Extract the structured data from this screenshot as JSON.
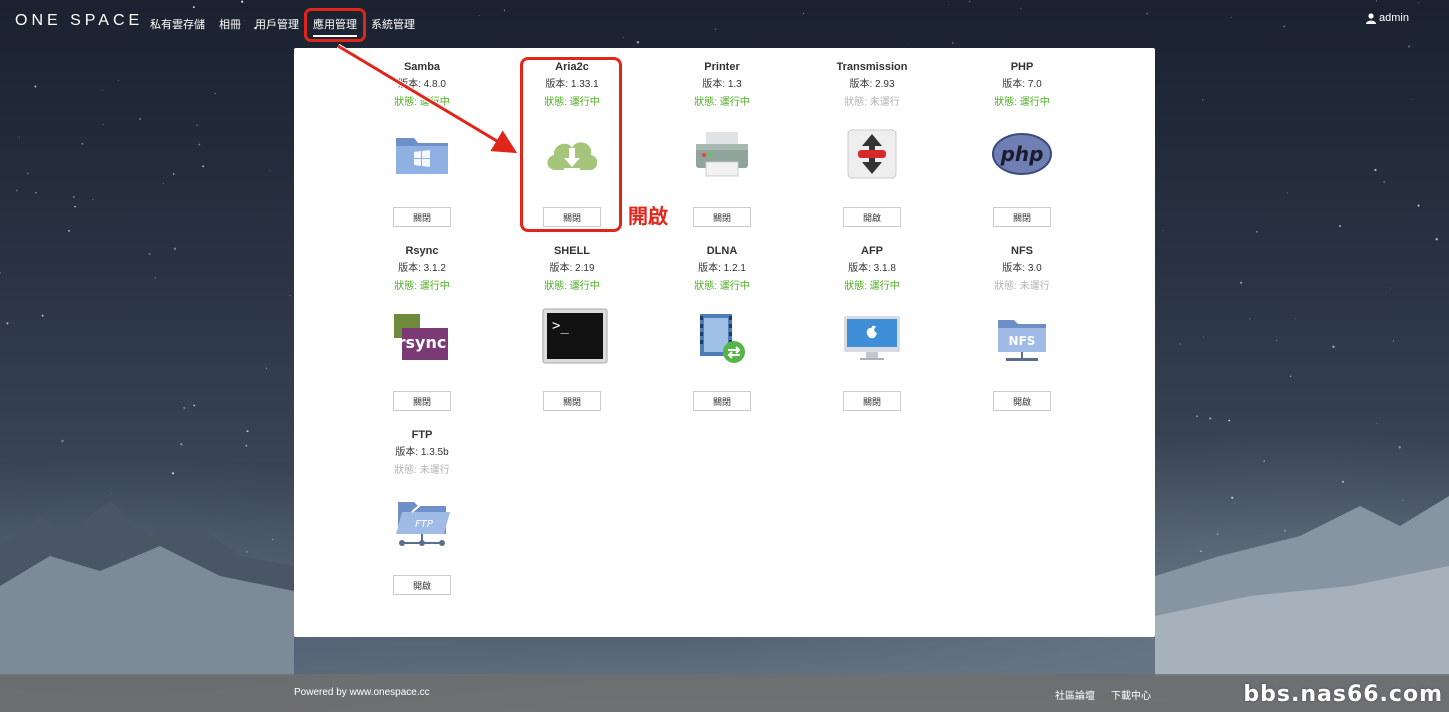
{
  "header": {
    "logo": "ONE SPACE",
    "nav": [
      "私有雲存儲",
      "相冊",
      "用戶管理",
      "應用管理",
      "系統管理"
    ],
    "user": "admin"
  },
  "apps": [
    {
      "name": "Samba",
      "version": "版本: 4.8.0",
      "status": "狀態: 運行中",
      "running": true,
      "button": "關閉",
      "icon": "folder-windows-icon"
    },
    {
      "name": "Aria2c",
      "version": "版本: 1.33.1",
      "status": "狀態: 運行中",
      "running": true,
      "button": "關閉",
      "icon": "cloud-download-icon"
    },
    {
      "name": "Printer",
      "version": "版本: 1.3",
      "status": "狀態: 運行中",
      "running": true,
      "button": "關閉",
      "icon": "printer-icon"
    },
    {
      "name": "Transmission",
      "version": "版本: 2.93",
      "status": "狀態: 未運行",
      "running": false,
      "button": "開啟",
      "icon": "transmission-icon"
    },
    {
      "name": "PHP",
      "version": "版本: 7.0",
      "status": "狀態: 運行中",
      "running": true,
      "button": "關閉",
      "icon": "php-icon"
    },
    {
      "name": "Rsync",
      "version": "版本: 3.1.2",
      "status": "狀態: 運行中",
      "running": true,
      "button": "關閉",
      "icon": "rsync-icon"
    },
    {
      "name": "SHELL",
      "version": "版本: 2.19",
      "status": "狀態: 運行中",
      "running": true,
      "button": "關閉",
      "icon": "terminal-icon"
    },
    {
      "name": "DLNA",
      "version": "版本: 1.2.1",
      "status": "狀態: 運行中",
      "running": true,
      "button": "關閉",
      "icon": "dlna-icon"
    },
    {
      "name": "AFP",
      "version": "版本: 3.1.8",
      "status": "狀態: 運行中",
      "running": true,
      "button": "關閉",
      "icon": "apple-monitor-icon"
    },
    {
      "name": "NFS",
      "version": "版本: 3.0",
      "status": "狀態: 未運行",
      "running": false,
      "button": "開啟",
      "icon": "nfs-folder-icon"
    },
    {
      "name": "FTP",
      "version": "版本: 1.3.5b",
      "status": "狀態: 未運行",
      "running": false,
      "button": "開啟",
      "icon": "ftp-folder-icon"
    }
  ],
  "annotation": "開啟",
  "footer": {
    "powered": "Powered by www.onespace.cc",
    "links": [
      "社區論壇",
      "下載中心"
    ],
    "watermark": "bbs.nas66.com"
  },
  "colors": {
    "running": "#4cae1f",
    "stopped": "#b3b3b3",
    "highlight": "#e0251b"
  }
}
